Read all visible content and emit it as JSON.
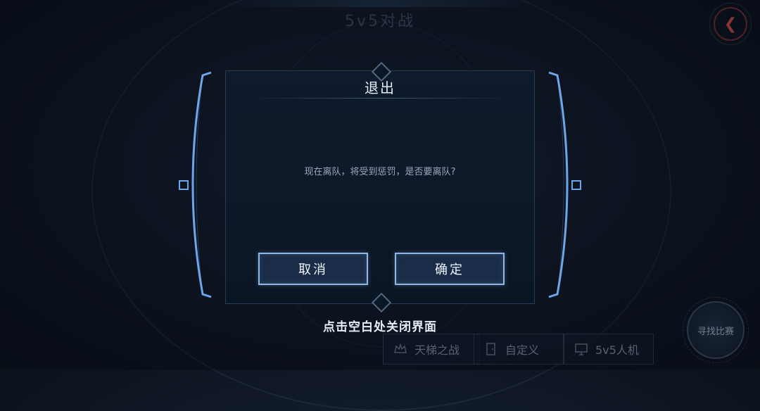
{
  "header": {
    "title": "5v5对战"
  },
  "dialog": {
    "title": "退出",
    "message": "现在离队，将受到惩罚，是否要离队?",
    "cancel_label": "取消",
    "confirm_label": "确定"
  },
  "close_hint": "点击空白处关闭界面",
  "modes": [
    {
      "label": "天梯之战",
      "icon": "crown-icon"
    },
    {
      "label": "自定义",
      "icon": "door-icon"
    },
    {
      "label": "5v5人机",
      "icon": "monitor-icon"
    }
  ],
  "match_button": {
    "label": "寻找比赛"
  },
  "colors": {
    "accent": "#6ea6ea",
    "back_button": "#d04d4d",
    "button_fill": "#1a2c47",
    "button_border": "#8fb8e6"
  }
}
